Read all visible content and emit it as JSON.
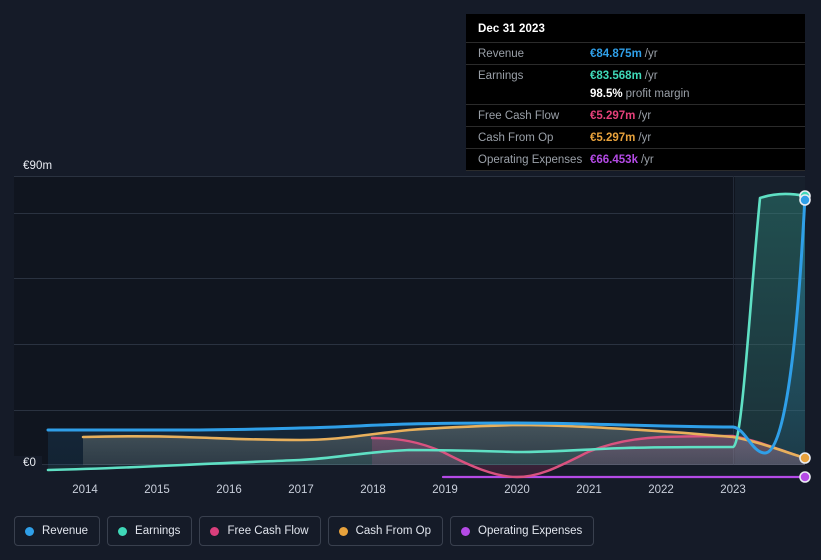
{
  "tooltip": {
    "title": "Dec 31 2023",
    "rows": [
      {
        "label": "Revenue",
        "value": "€84.875m",
        "unit": "/yr",
        "color": "#2f9fe8"
      },
      {
        "label": "Earnings",
        "value": "€83.568m",
        "unit": "/yr",
        "color": "#3fd8b8"
      },
      {
        "label": "",
        "value": "98.5%",
        "unit": "profit margin",
        "color": "#ffffff"
      },
      {
        "label": "Free Cash Flow",
        "value": "€5.297m",
        "unit": "/yr",
        "color": "#e6407a"
      },
      {
        "label": "Cash From Op",
        "value": "€5.297m",
        "unit": "/yr",
        "color": "#e8a23c"
      },
      {
        "label": "Operating Expenses",
        "value": "€66.453k",
        "unit": "/yr",
        "color": "#b44ae6"
      }
    ]
  },
  "legend": {
    "items": [
      {
        "label": "Revenue",
        "color": "#2f9fe8"
      },
      {
        "label": "Earnings",
        "color": "#3fd8b8"
      },
      {
        "label": "Free Cash Flow",
        "color": "#d93f7c"
      },
      {
        "label": "Cash From Op",
        "color": "#e8a23c"
      },
      {
        "label": "Operating Expenses",
        "color": "#b44ae6"
      }
    ]
  },
  "axis": {
    "y_top_label": "€90m",
    "y_bottom_label": "€0",
    "x_ticks": [
      "2014",
      "2015",
      "2016",
      "2017",
      "2018",
      "2019",
      "2020",
      "2021",
      "2022",
      "2023"
    ]
  },
  "chart_data": {
    "type": "line",
    "title": "",
    "xlabel": "",
    "ylabel": "",
    "currency": "EUR",
    "ylim": [
      0,
      90
    ],
    "yticks": [
      0,
      90
    ],
    "ytick_labels": [
      "€0",
      "€90m"
    ],
    "gridlines_y": [
      0,
      15,
      30,
      45,
      60,
      75,
      90
    ],
    "grid": true,
    "legend_position": "bottom-left",
    "x": [
      2013.6,
      2014,
      2015,
      2016,
      2017,
      2018,
      2019,
      2020,
      2021,
      2022,
      2023,
      2023.9
    ],
    "x_tick_labels": [
      "2014",
      "2015",
      "2016",
      "2017",
      "2018",
      "2019",
      "2020",
      "2021",
      "2022",
      "2023"
    ],
    "series": [
      {
        "name": "Revenue",
        "color": "#2f9fe8",
        "unit": "m",
        "values": [
          5.0,
          5.0,
          5.0,
          5.1,
          5.6,
          6.1,
          6.4,
          6.2,
          6.0,
          5.9,
          5.8,
          84.875
        ]
      },
      {
        "name": "Earnings",
        "color": "#3fd8b8",
        "unit": "m",
        "values": [
          1.1,
          1.1,
          1.5,
          1.4,
          1.6,
          2.5,
          2.2,
          2.1,
          2.2,
          2.0,
          2.0,
          83.568
        ]
      },
      {
        "name": "Free Cash Flow",
        "color": "#d93f7c",
        "unit": "m",
        "values": [
          null,
          null,
          null,
          null,
          null,
          3.6,
          2.9,
          0.2,
          3.5,
          3.9,
          3.4,
          5.297
        ]
      },
      {
        "name": "Cash From Op",
        "color": "#e8a23c",
        "unit": "m",
        "values": [
          null,
          4.3,
          4.3,
          4.1,
          4.9,
          5.4,
          5.6,
          6.0,
          5.8,
          5.4,
          4.4,
          5.297
        ]
      },
      {
        "name": "Operating Expenses",
        "color": "#b44ae6",
        "unit": "k",
        "values": [
          null,
          null,
          null,
          null,
          null,
          null,
          0.066,
          0.066,
          0.066,
          0.066,
          0.066,
          0.066
        ]
      }
    ],
    "highlight_point": {
      "date": "Dec 31 2023",
      "revenue": 84.875,
      "earnings": 83.568,
      "profit_margin_pct": 98.5,
      "free_cash_flow": 5.297,
      "cash_from_op": 5.297,
      "operating_expenses_k": 66.453
    }
  }
}
